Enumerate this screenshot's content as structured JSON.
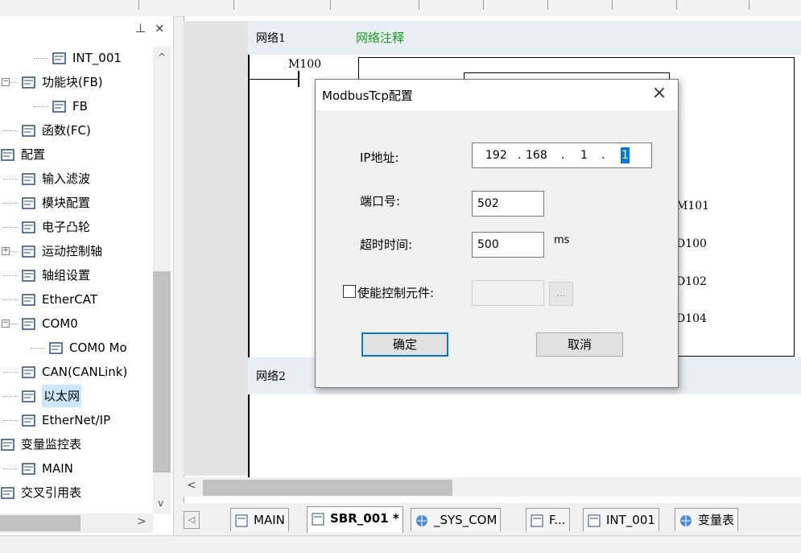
{
  "panel": {
    "pin_glyph": "⊥",
    "close_glyph": "×"
  },
  "tree_items": [
    {
      "label": "INT_001",
      "icon": "program-icon"
    },
    {
      "label": "功能块(FB)",
      "icon": "function-block-icon"
    },
    {
      "label": "FB",
      "icon": "fb-icon"
    },
    {
      "label": "函数(FC)",
      "icon": "function-icon"
    },
    {
      "label": "配置",
      "icon": "config-icon"
    },
    {
      "label": "输入滤波",
      "icon": "input-filter-icon"
    },
    {
      "label": "模块配置",
      "icon": "module-config-icon"
    },
    {
      "label": "电子凸轮",
      "icon": "electronic-cam-icon"
    },
    {
      "label": "运动控制轴",
      "icon": "motion-axis-icon"
    },
    {
      "label": "轴组设置",
      "icon": "axis-group-icon"
    },
    {
      "label": "EtherCAT",
      "icon": "ethercat-icon"
    },
    {
      "label": "COM0",
      "icon": "com-port-icon"
    },
    {
      "label": "COM0 Mo",
      "icon": "modbus-icon"
    },
    {
      "label": "CAN(CANLink)",
      "icon": "can-icon"
    },
    {
      "label": "以太网",
      "icon": "ethernet-icon"
    },
    {
      "label": "EtherNet/IP",
      "icon": "ethernet-ip-icon"
    },
    {
      "label": "变量监控表",
      "icon": "monitor-icon"
    },
    {
      "label": "MAIN",
      "icon": "main-program-icon"
    },
    {
      "label": "交叉引用表",
      "icon": "cross-reference-icon"
    }
  ],
  "editor": {
    "network1_label": "网络1",
    "network1_comment": "网络注释",
    "network2_label": "网络2",
    "contact_label": "M100",
    "outputs": [
      "M101",
      "D100",
      "D102",
      "D104"
    ]
  },
  "tabs": [
    {
      "label": "MAIN",
      "icon": "program-icon",
      "bold": false
    },
    {
      "label": "SBR_001 *",
      "icon": "subroutine-icon",
      "bold": true
    },
    {
      "label": "_SYS_COM",
      "icon": "globe-icon",
      "bold": false
    },
    {
      "label": "F...",
      "icon": "fb-icon",
      "bold": false
    },
    {
      "label": "INT_001",
      "icon": "program-icon",
      "bold": false
    },
    {
      "label": "变量表",
      "icon": "globe-icon",
      "bold": false
    }
  ],
  "dialog": {
    "title": "ModbusTcp配置",
    "ip_label": "IP地址:",
    "ip_octets": [
      "192",
      "168",
      "1",
      "1"
    ],
    "port_label": "端口号:",
    "port_value": "502",
    "timeout_label": "超时时间:",
    "timeout_value": "500",
    "timeout_unit": "ms",
    "enable_label": "使能控制元件:",
    "browse_label": "...",
    "ok_label": "确定",
    "cancel_label": "取消"
  },
  "colors": {
    "comment_green": "#1a9a1a",
    "accent_blue": "#0078d7"
  }
}
